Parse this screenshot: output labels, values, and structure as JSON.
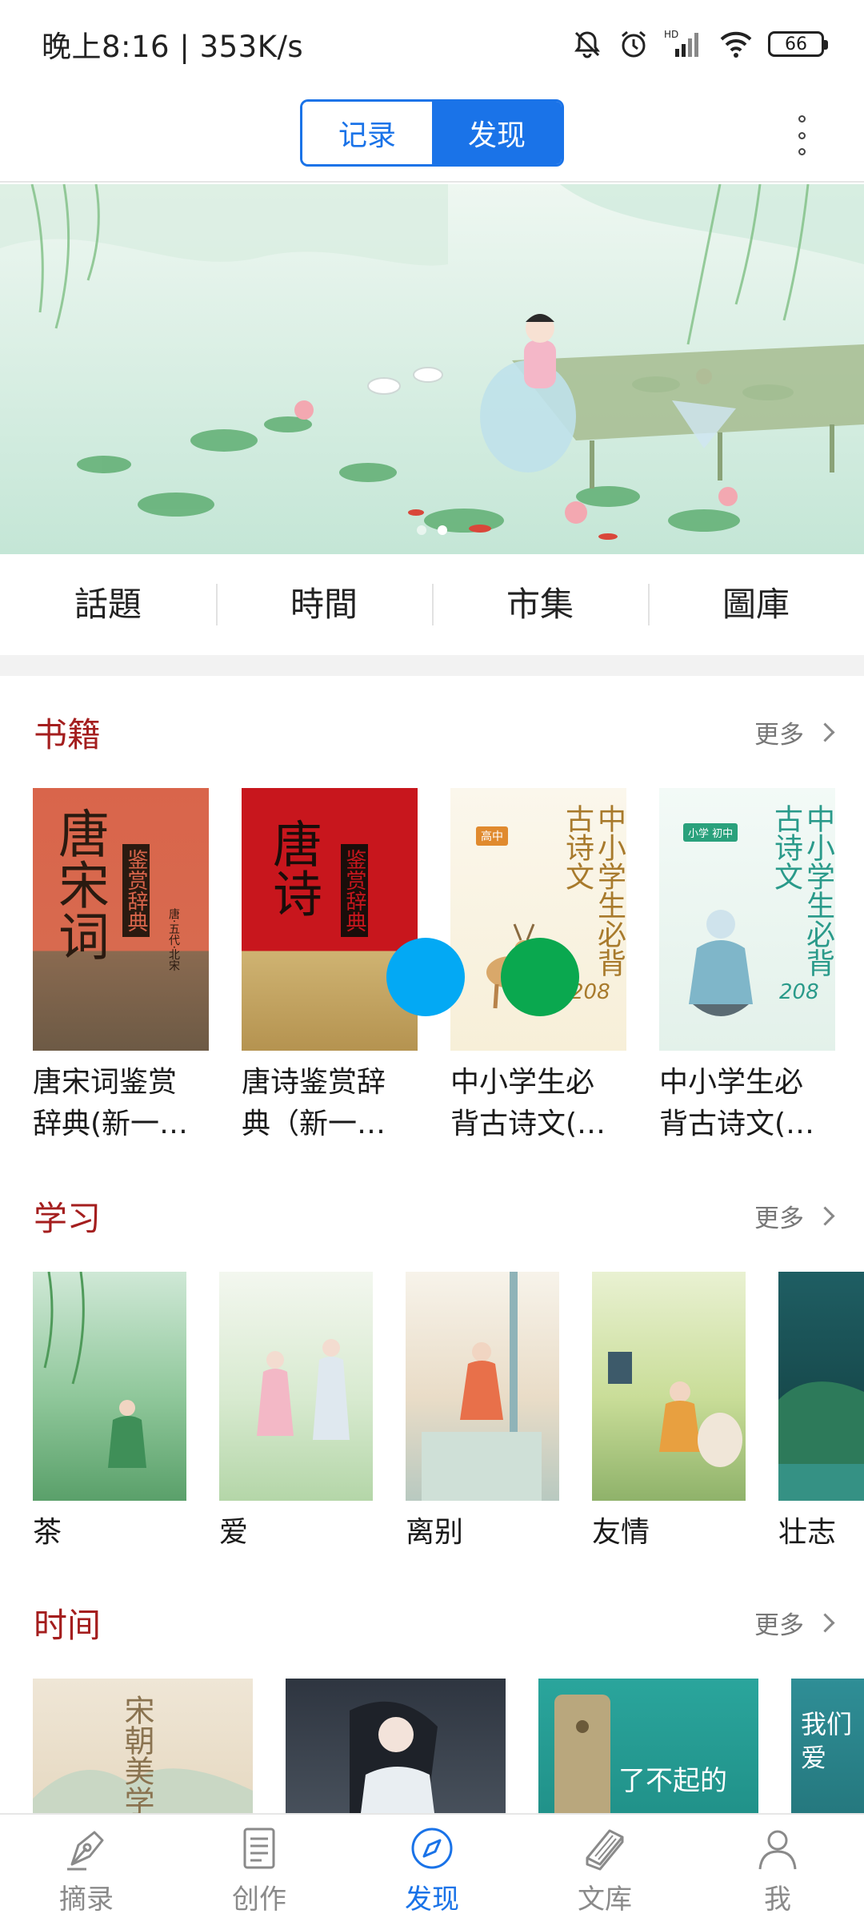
{
  "status": {
    "time": "晚上8:16 | 353K/s",
    "battery": "66"
  },
  "header": {
    "tabs": [
      {
        "label": "记录",
        "active": false
      },
      {
        "label": "发现",
        "active": true
      }
    ],
    "accent": "#1a73e8"
  },
  "banner": {
    "page_count": 2,
    "active_page": 2
  },
  "categories": [
    "話題",
    "時間",
    "市集",
    "圖庫"
  ],
  "books_section": {
    "title": "书籍",
    "more": "更多",
    "items": [
      {
        "title_line1": "唐宋词鉴赏",
        "title_line2": "辞典(新一…",
        "cover_text": "唐宋词",
        "cover_seal": "鉴赏辞典",
        "cover_sub": "唐·五代·北宋"
      },
      {
        "title_line1": "唐诗鉴赏辞",
        "title_line2": "典（新一…",
        "cover_text": "唐诗",
        "cover_seal": "鉴赏辞典"
      },
      {
        "title_line1": "中小学生必",
        "title_line2": "背古诗文(…",
        "cover_text": "中小学生必背古诗文",
        "cover_tag": "高中",
        "cover_num": "208"
      },
      {
        "title_line1": "中小学生必",
        "title_line2": "背古诗文(…",
        "cover_text": "中小学生必背古诗文",
        "cover_tag": "小学 初中",
        "cover_num": "208"
      }
    ]
  },
  "study_section": {
    "title": "学习",
    "more": "更多",
    "items": [
      {
        "title": "茶"
      },
      {
        "title": "爱"
      },
      {
        "title": "离别"
      },
      {
        "title": "友情"
      },
      {
        "title": "壮志"
      }
    ]
  },
  "time_section": {
    "title": "时间",
    "more": "更多",
    "items": [
      {
        "cover_text": "宋朝美学"
      },
      {
        "cover_text": ""
      },
      {
        "cover_text": "了不起的"
      },
      {
        "cover_text": "我们爱"
      }
    ]
  },
  "float_dots": {
    "blue": "#03a9f4",
    "green": "#0aa84f"
  },
  "bottom_nav": [
    {
      "label": "摘录",
      "icon": "pen-nib-icon",
      "active": false
    },
    {
      "label": "创作",
      "icon": "document-icon",
      "active": false
    },
    {
      "label": "发现",
      "icon": "compass-icon",
      "active": true
    },
    {
      "label": "文库",
      "icon": "books-icon",
      "active": false
    },
    {
      "label": "我",
      "icon": "person-icon",
      "active": false
    }
  ]
}
